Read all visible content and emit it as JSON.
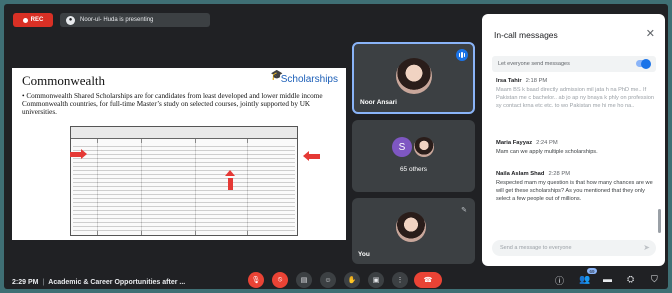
{
  "top": {
    "rec_label": "REC",
    "presenting_text": "Noor-ul- Huda is presenting"
  },
  "slide": {
    "title": "Commonwealth",
    "logo_text": "Scholarships",
    "body": "• Commonwealth Shared Scholarships are for candidates from least developed and lower middle income Commonwealth countries, for full-time Master’s study on selected courses, jointly supported by UK universities."
  },
  "tiles": {
    "noor_name": "Noor Ansari",
    "others_initial": "S",
    "others_count": "65 others",
    "you_name": "You"
  },
  "chat": {
    "title": "In-call messages",
    "allow_label": "Let everyone send messages",
    "messages": [
      {
        "sender": "Irsa Tahir",
        "time": "2:18 PM",
        "text": "Maam BS k baad directly admission mil jata h na PhD me.. If Pakistan me c bachelor.. ab jo ap ny bnaya k phly on profession sy contact krna etc etc. to wo Pakistan me hi me ho na.."
      },
      {
        "sender": "Maria Fayyaz",
        "time": "2:24 PM",
        "text": "Mam can we apply  multiple scholarships."
      },
      {
        "sender": "Naila Aslam Shad",
        "time": "2:28 PM",
        "text": "Respected mam my question is that how many chances are we will get these scholarships? As you mentioned that they only select a few people out of millions."
      }
    ],
    "input_placeholder": "Send a message to everyone"
  },
  "bottom": {
    "time": "2:29 PM",
    "separator": "|",
    "meeting_title": "Academic & Career Opportunities after ...",
    "people_count": "69"
  },
  "colors": {
    "background": "#3f6f74",
    "frame": "#202124",
    "accent_blue": "#1a73e8",
    "red": "#ea4335"
  }
}
